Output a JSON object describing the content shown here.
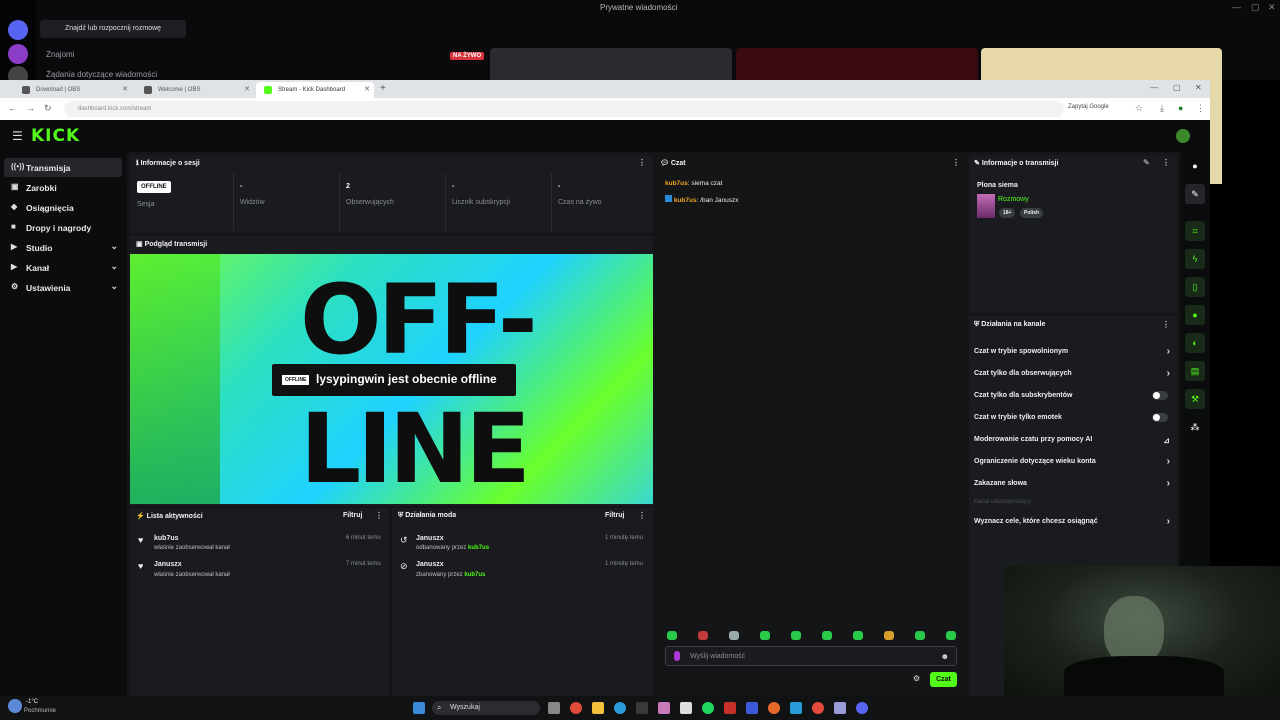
{
  "discord": {
    "window_title": "Prywatne wiadomości",
    "search_label": "Znajdź lub rozpocznij rozmowę",
    "friends_label": "Znajomi",
    "requests_label": "Żądania dotyczące wiadomości",
    "live_badge": "NA ŻYWO"
  },
  "browser": {
    "tabs": [
      {
        "label": "Download | OBS"
      },
      {
        "label": "Welcome | OBS"
      },
      {
        "label": "Stream - Kick Dashboard"
      }
    ],
    "new_tab": "+",
    "url": "dashboard.kick.com/stream",
    "translate_label": "Zapytaj Google"
  },
  "app": {
    "logo": "KICK",
    "sidebar": [
      {
        "label": "Transmisja",
        "icon": "broadcast-icon",
        "glyph": "((•))"
      },
      {
        "label": "Zarobki",
        "icon": "money-icon",
        "glyph": "▣"
      },
      {
        "label": "Osiągnięcia",
        "icon": "trophy-icon",
        "glyph": "◆"
      },
      {
        "label": "Dropy i nagrody",
        "icon": "gift-icon",
        "glyph": "■"
      },
      {
        "label": "Studio",
        "icon": "studio-icon",
        "glyph": "▶"
      },
      {
        "label": "Kanał",
        "icon": "channel-icon",
        "glyph": "▶"
      },
      {
        "label": "Ustawienia",
        "icon": "settings-icon",
        "glyph": "⚙"
      }
    ]
  },
  "session": {
    "title": "Informacje o sesji",
    "offline_badge": "OFFLINE",
    "session_label": "Sesja",
    "stats": [
      {
        "value": "-",
        "label": "Widzów"
      },
      {
        "value": "2",
        "label": "Obserwujących"
      },
      {
        "value": "-",
        "label": "Licznik subskrypcji"
      },
      {
        "value": "-",
        "label": "Czas na żywo"
      }
    ]
  },
  "preview": {
    "title": "Podgląd transmisji",
    "offline_text_top": "OFF-",
    "offline_text_bottom": "LINE",
    "badge": "OFFLINE",
    "message": "lysypingwin jest obecnie offline"
  },
  "activity": {
    "title": "Lista aktywności",
    "filter": "Filtruj",
    "items": [
      {
        "name": "kub7us",
        "sub": "właśnie zaobserwował kanał",
        "time": "6 minut temu"
      },
      {
        "name": "Januszx",
        "sub": "właśnie zaobserwował kanał",
        "time": "7 minut temu"
      }
    ]
  },
  "mod": {
    "title": "Działania moda",
    "filter": "Filtruj",
    "items": [
      {
        "name": "Januszx",
        "action": "odbanowany przez",
        "by": "kub7us",
        "time": "1 minutę temu"
      },
      {
        "name": "Januszx",
        "action": "zbanowany przez",
        "by": "kub7us",
        "time": "1 minutę temu"
      }
    ]
  },
  "chat": {
    "title": "Czat",
    "messages": [
      {
        "user": "kub7us",
        "text": ": siema czat"
      },
      {
        "user": "kub7us",
        "text": ": /ban Januszx"
      }
    ],
    "input_placeholder": "Wyślij wiadomość",
    "send_label": "Czat"
  },
  "stream_info": {
    "title": "Informacje o transmisji",
    "stream_title": "Plona siema",
    "category": "Rozmowy",
    "tags": [
      "18+",
      "Polish"
    ]
  },
  "channel_actions": {
    "title": "Działania na kanale",
    "items": [
      {
        "label": "Czat w trybie spowolnionym",
        "control": "arrow"
      },
      {
        "label": "Czat tylko dla obserwujących",
        "control": "arrow"
      },
      {
        "label": "Czat tylko dla subskrybentów",
        "control": "toggle"
      },
      {
        "label": "Czat w trybie tylko emotek",
        "control": "toggle"
      },
      {
        "label": "Moderowanie czatu przy pomocy AI",
        "control": "chart"
      },
      {
        "label": "Ograniczenie dotyczące wieku konta",
        "control": "arrow"
      },
      {
        "label": "Zakazane słowa",
        "control": "arrow"
      }
    ],
    "disabled_label": "Kanał udostępniający",
    "goals_label": "Wyznacz cele, które chcesz osiągnąć"
  },
  "taskbar": {
    "weather": "-1°C",
    "weather_sub": "Pochmurnie",
    "search": "Wyszukaj"
  },
  "colors": {
    "brand": "#53fc18",
    "panel": "#191b1f",
    "background": "#0b0c0d"
  }
}
